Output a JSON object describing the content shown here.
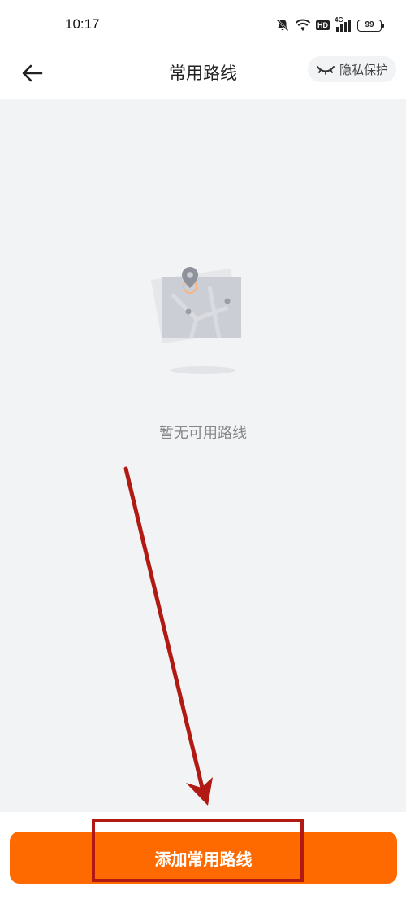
{
  "status_bar": {
    "time": "10:17",
    "battery_level": "99",
    "network_label": "4G",
    "hd_label": "HD",
    "icons": [
      "mute-bell-icon",
      "wifi-icon",
      "hd-icon",
      "signal-icon",
      "battery-icon"
    ]
  },
  "header": {
    "title": "常用路线",
    "back_icon": "arrow-left-icon",
    "privacy_label": "隐私保护",
    "privacy_icon": "closed-eye-icon"
  },
  "empty_state": {
    "illustration_icon": "empty-map-icon",
    "message": "暂无可用路线"
  },
  "bottom_bar": {
    "add_button_label": "添加常用路线"
  },
  "colors": {
    "accent": "#ff6a00",
    "background": "#f2f3f5",
    "annotation": "#b11a12"
  }
}
